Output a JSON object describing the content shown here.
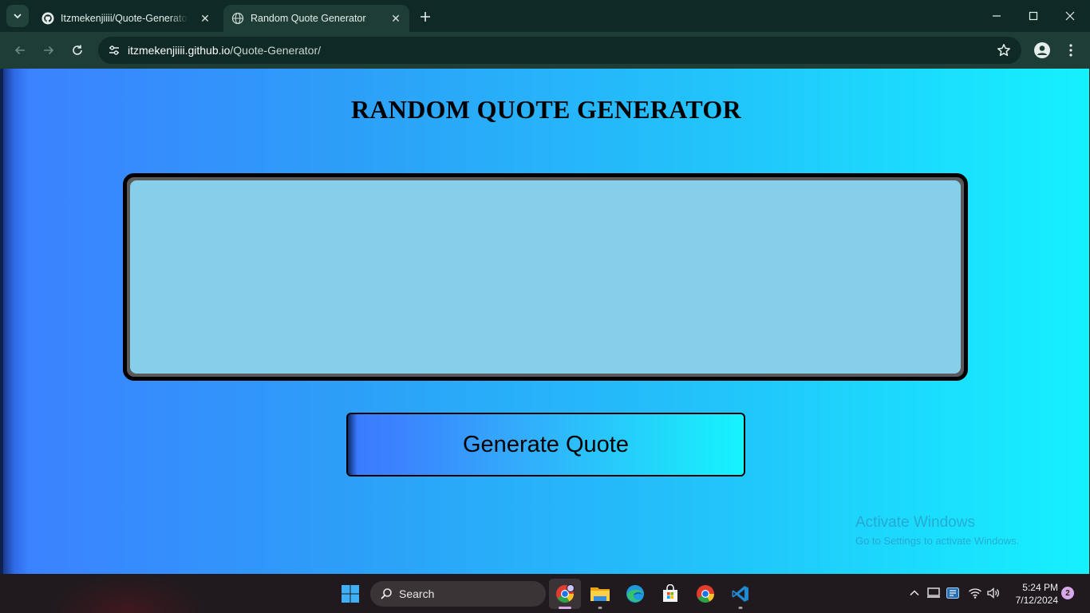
{
  "browser": {
    "tabs": [
      {
        "title": "Itzmekenjiiii/Quote-Generator: T",
        "favicon": "github-icon",
        "active": false
      },
      {
        "title": "Random Quote Generator",
        "favicon": "globe-icon",
        "active": true
      }
    ],
    "url_host": "itzmekenjiiii.github.io",
    "url_path": "/Quote-Generator/"
  },
  "page": {
    "title": "RANDOM QUOTE GENERATOR",
    "quote_text": "",
    "button_label": "Generate Quote"
  },
  "watermark": {
    "line1": "Activate Windows",
    "line2": "Go to Settings to activate Windows."
  },
  "taskbar": {
    "search_label": "Search",
    "apps": [
      "chrome-profile-icon",
      "file-explorer-icon",
      "edge-icon",
      "microsoft-store-icon",
      "chrome-icon",
      "vscode-icon"
    ],
    "time": "5:24 PM",
    "date": "7/12/2024",
    "notification_count": "2"
  },
  "colors": {
    "page_gradient_start": "#3b82ff",
    "page_gradient_end": "#15f1ff",
    "quote_box_fill": "#87ceeb",
    "browser_chrome": "#0f2a26"
  }
}
